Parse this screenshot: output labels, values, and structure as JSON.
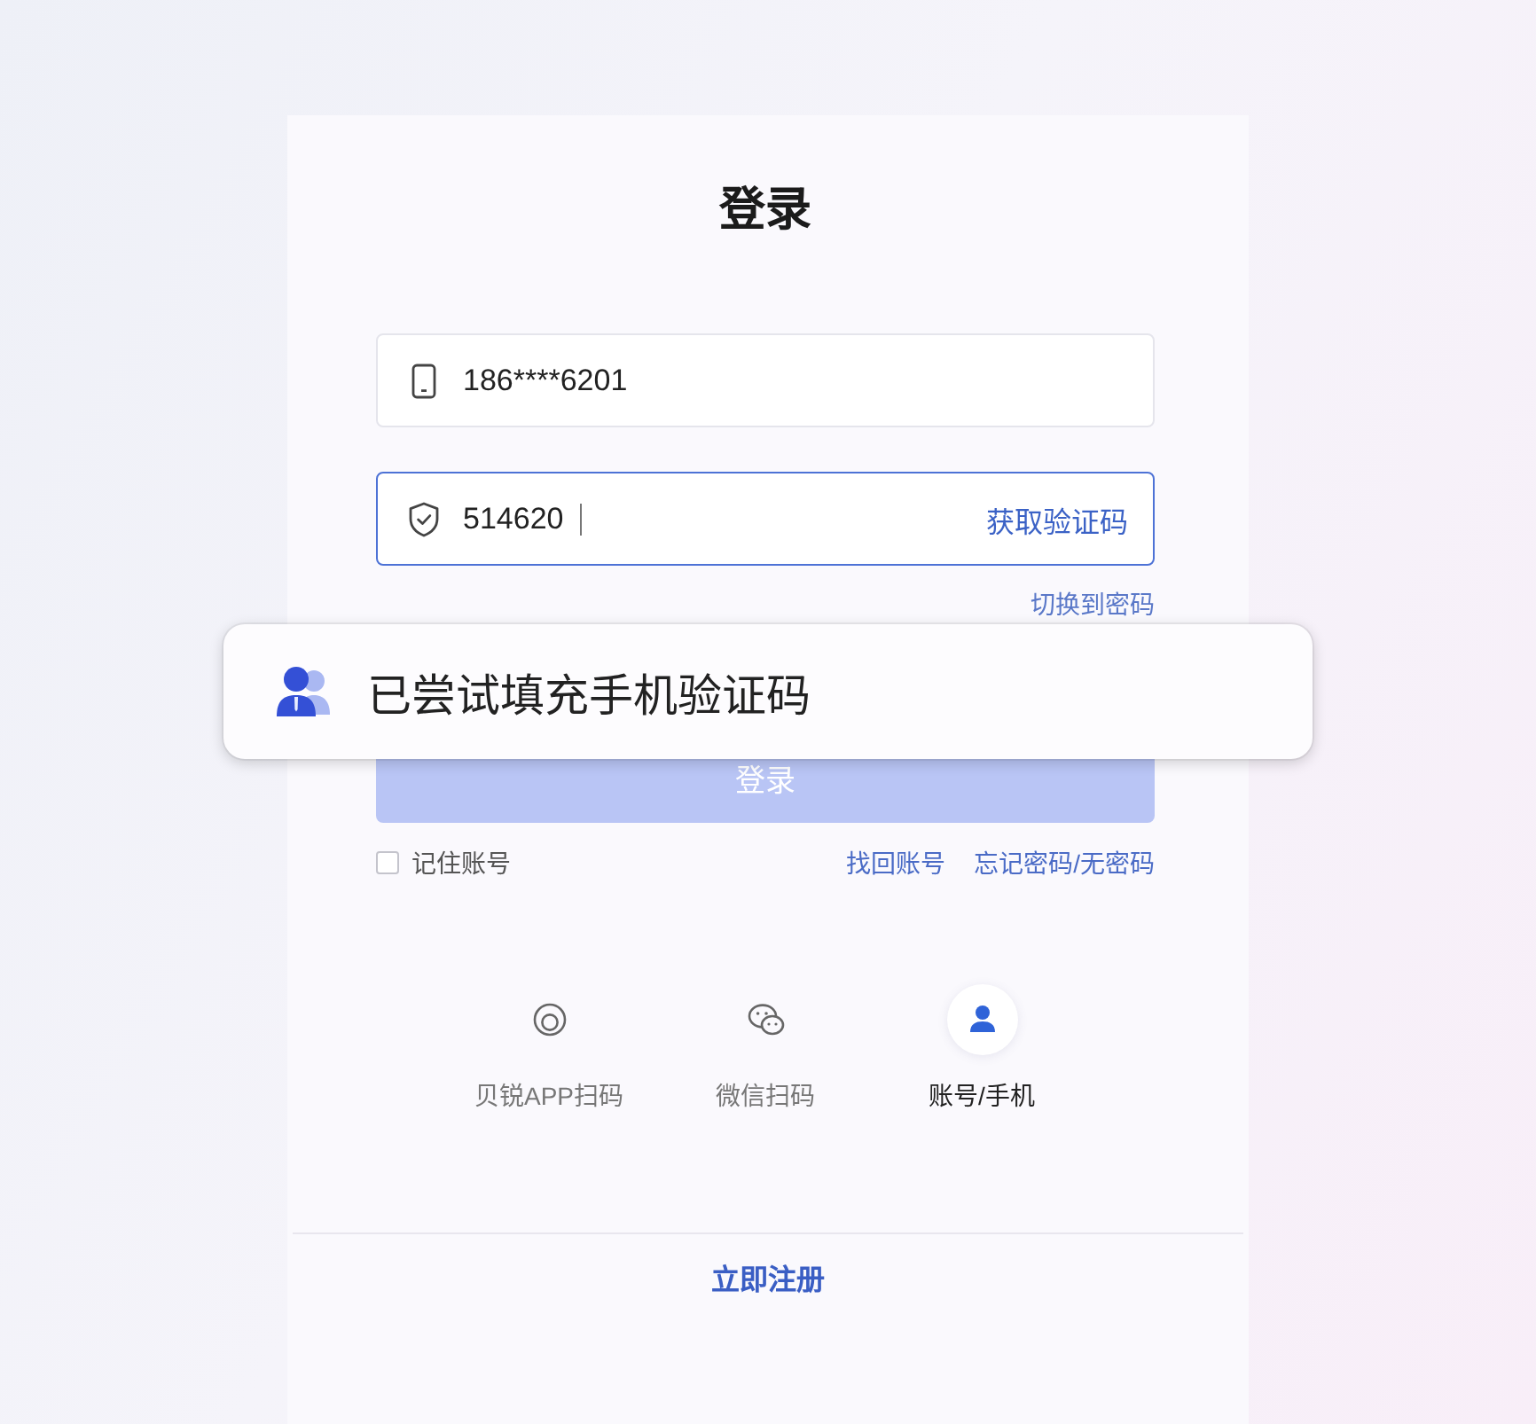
{
  "title": "登录",
  "fields": [
    {
      "kind": "phone",
      "value": "186****6201",
      "focused": false
    },
    {
      "kind": "code",
      "value": "514620",
      "focused": true,
      "action": "获取验证码"
    }
  ],
  "switch_link": "切换到密码",
  "login_button": {
    "label": "登录",
    "disabled": true
  },
  "remember": {
    "label": "记住账号",
    "checked": false
  },
  "links": [
    "找回账号",
    "忘记密码/无密码"
  ],
  "login_methods": [
    {
      "kind": "app",
      "label": "贝锐APP扫码",
      "selected": false
    },
    {
      "kind": "wechat",
      "label": "微信扫码",
      "selected": false
    },
    {
      "kind": "account",
      "label": "账号/手机",
      "selected": true
    }
  ],
  "register_link": "立即注册",
  "toast": {
    "message": "已尝试填充手机验证码"
  }
}
